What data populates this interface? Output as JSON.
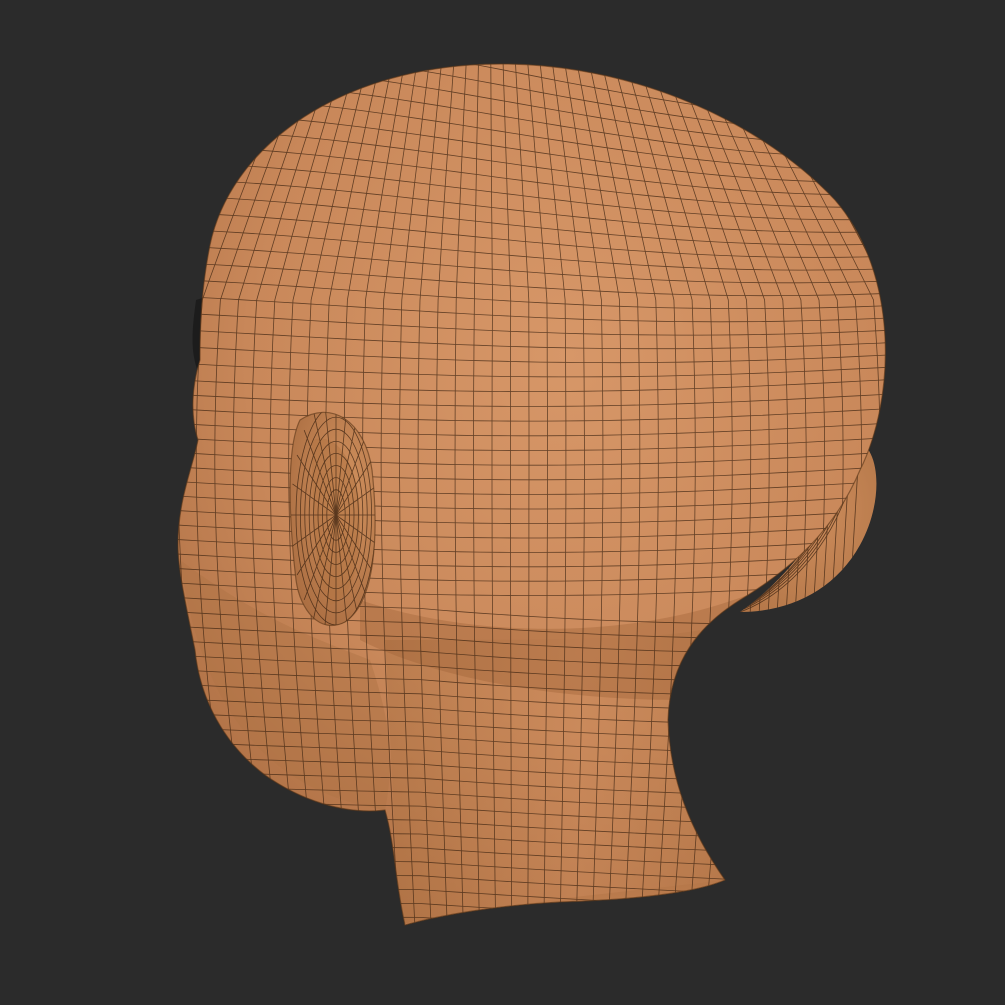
{
  "viewport": {
    "background": "#2b2b2b",
    "subject": "head-mesh",
    "shading": "solid-with-wireframe"
  },
  "colors": {
    "skin_light": "#d9976a",
    "skin_mid": "#c78556",
    "skin_dark": "#a86a3e",
    "skin_shadow": "#8e5730",
    "wire": "#3a2210",
    "eye_white": "#e6e6e6",
    "eye_dark": "#1c1c1c"
  }
}
